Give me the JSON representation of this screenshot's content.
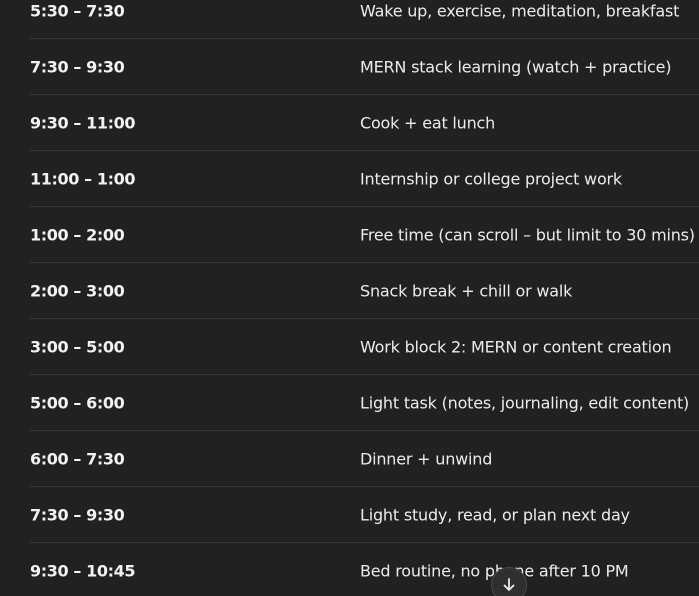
{
  "schedule": {
    "rows": [
      {
        "time": "5:30 – 7:30",
        "activity": "Wake up, exercise, meditation, breakfast"
      },
      {
        "time": "7:30 – 9:30",
        "activity": "MERN stack learning (watch + practice)"
      },
      {
        "time": "9:30 – 11:00",
        "activity": "Cook + eat lunch"
      },
      {
        "time": "11:00 – 1:00",
        "activity": "Internship or college project work"
      },
      {
        "time": "1:00 – 2:00",
        "activity": "Free time (can scroll – but limit to 30 mins)"
      },
      {
        "time": "2:00 – 3:00",
        "activity": "Snack break + chill or walk"
      },
      {
        "time": "3:00 – 5:00",
        "activity": "Work block 2: MERN or content creation"
      },
      {
        "time": "5:00 – 6:00",
        "activity": "Light task (notes, journaling, edit content)"
      },
      {
        "time": "6:00 – 7:30",
        "activity": "Dinner + unwind"
      },
      {
        "time": "7:30 – 9:30",
        "activity": "Light study, read, or plan next day"
      },
      {
        "time": "9:30 – 10:45",
        "activity": "Bed routine, no phone after 10 PM"
      }
    ]
  },
  "scroll_button": {
    "icon": "arrow-down-icon"
  },
  "colors": {
    "background": "#212121",
    "text": "#ececec",
    "divider": "#363636"
  }
}
